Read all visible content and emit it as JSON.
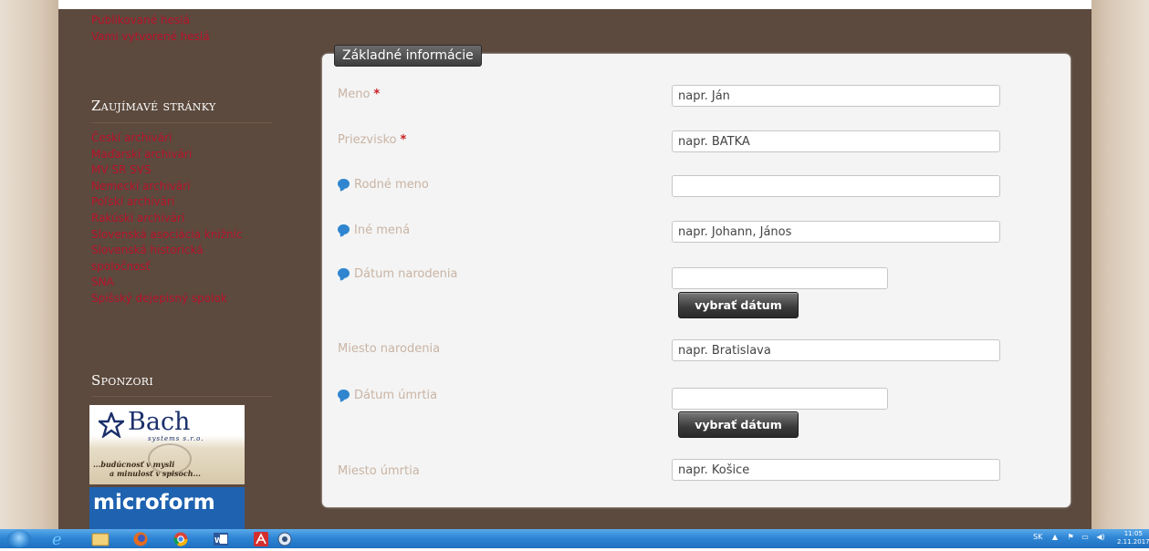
{
  "sidebar": {
    "user_links": [
      "Publikované heslá",
      "Vami vytvorené heslá"
    ],
    "interesting_heading": "Zaujímavé stránky",
    "interesting_links": [
      "Českí archivári",
      "Maďarskí archivári",
      "MV SR SVS",
      "Nemeckí archivári",
      "Poľskí archivári",
      "Rakúski archivári",
      "Slovenská asociácia knižníc",
      "Slovenská historická",
      "spoločnosť",
      "SNA",
      "Spišský dejepisný spolok"
    ],
    "sponsors_heading": "Sponzori",
    "sponsor_bach": {
      "name": "Bach",
      "sub": "systems s.r.o.",
      "slogan_line1": "...budúcnosť v mysli",
      "slogan_line2": "a minulosť v spisoch..."
    },
    "sponsor_microform": "microform"
  },
  "form": {
    "legend": "Základné informácie",
    "required_mark": "*",
    "fields": [
      {
        "label": "Meno",
        "required": true,
        "info": false,
        "placeholder": "napr. Ján",
        "value": ""
      },
      {
        "label": "Priezvisko",
        "required": true,
        "info": false,
        "placeholder": "napr. BATKA",
        "value": ""
      },
      {
        "label": "Rodné meno",
        "required": false,
        "info": true,
        "placeholder": "",
        "value": ""
      },
      {
        "label": "Iné mená",
        "required": false,
        "info": true,
        "placeholder": "napr. Johann, János",
        "value": ""
      },
      {
        "label": "Dátum narodenia",
        "required": false,
        "info": true,
        "placeholder": "",
        "value": "",
        "button": "vybrať dátum"
      },
      {
        "label": "Miesto narodenia",
        "required": false,
        "info": false,
        "placeholder": "napr. Bratislava",
        "value": ""
      },
      {
        "label": "Dátum úmrtia",
        "required": false,
        "info": true,
        "placeholder": "",
        "value": "",
        "button": "vybrať dátum"
      },
      {
        "label": "Miesto úmrtia",
        "required": false,
        "info": false,
        "placeholder": "napr. Košice",
        "value": ""
      }
    ]
  },
  "taskbar": {
    "language": "SK",
    "time": "11:05",
    "date": "2.11.2017"
  },
  "colors": {
    "background": "#5c4a3e",
    "link": "#b8122a",
    "panel": "#f4f4f4",
    "label": "#c9b4a4",
    "required": "#c81e1e",
    "info_icon": "#2f85cf"
  }
}
